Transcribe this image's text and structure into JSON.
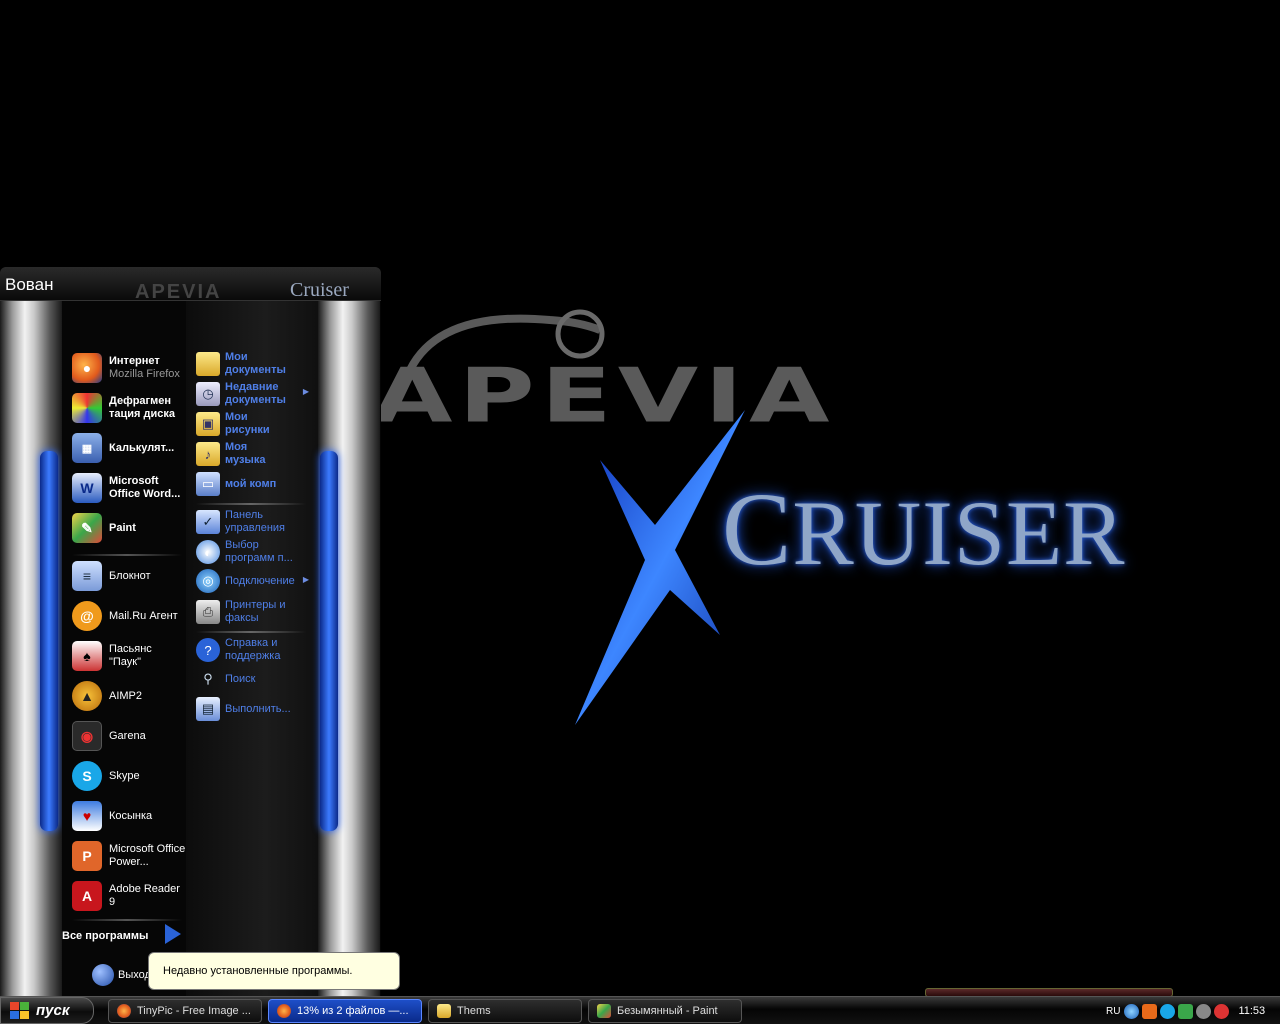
{
  "wallpaper": {
    "brand_top": "APEVIA",
    "brand_bottom_cap": "C",
    "brand_bottom": "RUISER"
  },
  "start_menu": {
    "user_name": "Вован",
    "header_brand": "Cruiser",
    "pinned": [
      {
        "name": "Интернет",
        "sub": "Mozilla Firefox",
        "icon": "firefox-icon"
      },
      {
        "name": "Дефрагмен тация диска",
        "icon": "defrag-icon"
      },
      {
        "name": "Калькулят...",
        "icon": "calculator-icon"
      },
      {
        "name": "Microsoft Office Word...",
        "icon": "word-icon"
      },
      {
        "name": "Paint",
        "icon": "paint-icon"
      }
    ],
    "recent": [
      {
        "name": "Блокнот",
        "icon": "notepad-icon"
      },
      {
        "name": "Mail.Ru Агент",
        "icon": "mailru-agent-icon"
      },
      {
        "name": "Пасьянс \"Паук\"",
        "icon": "spider-solitaire-icon"
      },
      {
        "name": "AIMP2",
        "icon": "aimp-icon"
      },
      {
        "name": "Garena",
        "icon": "garena-icon"
      },
      {
        "name": "Skype",
        "icon": "skype-icon"
      },
      {
        "name": "Косынка",
        "icon": "solitaire-icon"
      },
      {
        "name": "Microsoft Office Power...",
        "icon": "powerpoint-icon"
      },
      {
        "name": "Adobe Reader 9",
        "icon": "adobe-reader-icon"
      }
    ],
    "places": [
      {
        "label": "Мои документы",
        "icon": "folder-icon"
      },
      {
        "label": "Недавние документы",
        "icon": "recent-docs-icon"
      },
      {
        "label": "Мои рисунки",
        "icon": "pictures-folder-icon"
      },
      {
        "label": "Моя музыка",
        "icon": "music-folder-icon"
      },
      {
        "label": "мой комп",
        "icon": "computer-icon"
      }
    ],
    "system": [
      {
        "label": "Панель управления",
        "icon": "control-panel-icon"
      },
      {
        "label": "Выбор программ п...",
        "icon": "set-defaults-icon"
      },
      {
        "label": "Подключение",
        "icon": "network-icon"
      },
      {
        "label": "Принтеры и факсы",
        "icon": "printer-icon"
      },
      {
        "label": "Справка и поддержка",
        "icon": "help-icon"
      },
      {
        "label": "Поиск",
        "icon": "search-icon"
      },
      {
        "label": "Выполнить...",
        "icon": "run-icon"
      }
    ],
    "all_programs": "Все программы",
    "logoff": "Выход",
    "tooltip": "Недавно установленные программы."
  },
  "taskbar": {
    "start_label": "пуск",
    "tasks": [
      {
        "label": "TinyPic - Free Image ...",
        "icon": "firefox-icon"
      },
      {
        "label": "13% из 2 файлов —...",
        "icon": "firefox-icon"
      },
      {
        "label": "Thems",
        "icon": "folder-icon"
      },
      {
        "label": "Безымянный - Paint",
        "icon": "paint-icon"
      }
    ],
    "language": "RU",
    "clock": "11:53"
  },
  "colors": {
    "accent_blue": "#3c7bff",
    "link_blue": "#4f7fe8",
    "tooltip_bg": "#ffffe1"
  }
}
